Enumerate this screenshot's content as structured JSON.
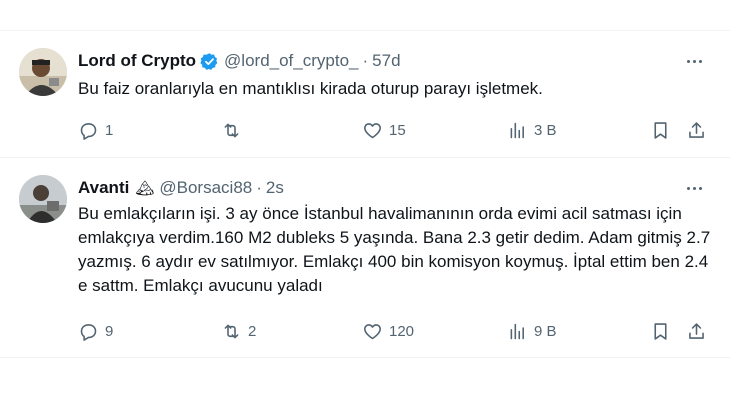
{
  "tweets": [
    {
      "author_name": "Lord of Crypto",
      "verified": true,
      "handle": "@lord_of_crypto_",
      "separator": "·",
      "time": "57d",
      "text": "Bu faiz oranlarıyla en mantıklısı kirada oturup parayı işletmek.",
      "reply_count": "1",
      "retweet_count": "",
      "like_count": "15",
      "view_count": "3 B"
    },
    {
      "author_name": "Avanti",
      "emoji": "🏔",
      "handle": "@Borsaci88",
      "separator": "·",
      "time": "2s",
      "text": "Bu emlakçıların işi. 3 ay önce İstanbul havalimanının orda evimi acil satması için emlakçıya verdim.160 M2 dubleks 5 yaşında. Bana 2.3 getir dedim. Adam gitmiş 2.7 yazmış. 6 aydır ev satılmıyor. Emlakçı 400 bin komisyon koymuş. İptal ettim ben 2.4 e sattm. Emlakçı avucunu yaladı",
      "reply_count": "9",
      "retweet_count": "2",
      "like_count": "120",
      "view_count": "9 B"
    }
  ],
  "colors": {
    "verified": "#1d9bf0",
    "muted": "#536471",
    "text": "#0f1419",
    "divider": "#eff3f4"
  },
  "icons": [
    "reply-icon",
    "retweet-icon",
    "like-icon",
    "views-icon",
    "bookmark-icon",
    "share-icon",
    "more-icon",
    "verified-badge-icon"
  ]
}
